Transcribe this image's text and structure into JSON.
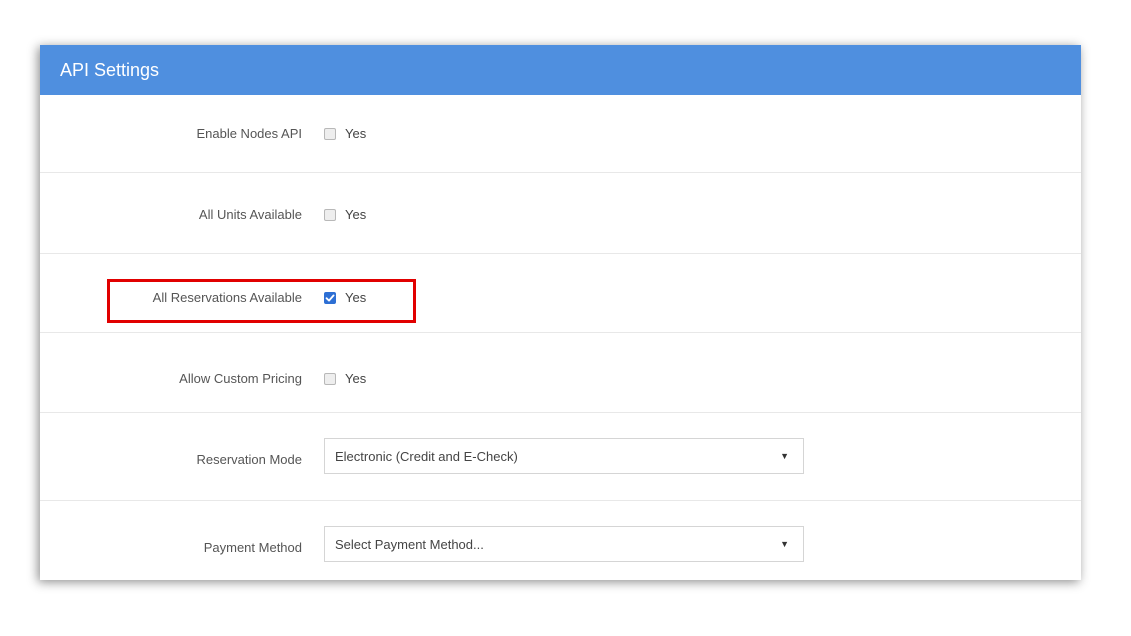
{
  "panel": {
    "title": "API Settings"
  },
  "settings": [
    {
      "label": "Enable Nodes API",
      "type": "checkbox",
      "checked": false,
      "option_label": "Yes"
    },
    {
      "label": "All Units Available",
      "type": "checkbox",
      "checked": false,
      "option_label": "Yes"
    },
    {
      "label": "All Reservations Available",
      "type": "checkbox",
      "checked": true,
      "option_label": "Yes"
    },
    {
      "label": "Allow Custom Pricing",
      "type": "checkbox",
      "checked": false,
      "option_label": "Yes"
    },
    {
      "label": "Reservation Mode",
      "type": "select",
      "value": "Electronic (Credit and E-Check)"
    },
    {
      "label": "Payment Method",
      "type": "select",
      "value": "Select Payment Method..."
    }
  ],
  "colors": {
    "header": "#4f8fdf",
    "highlight": "#e10000",
    "checkbox_checked": "#2d6fd4"
  },
  "annotation": {
    "highlighted_setting": "All Reservations Available"
  }
}
